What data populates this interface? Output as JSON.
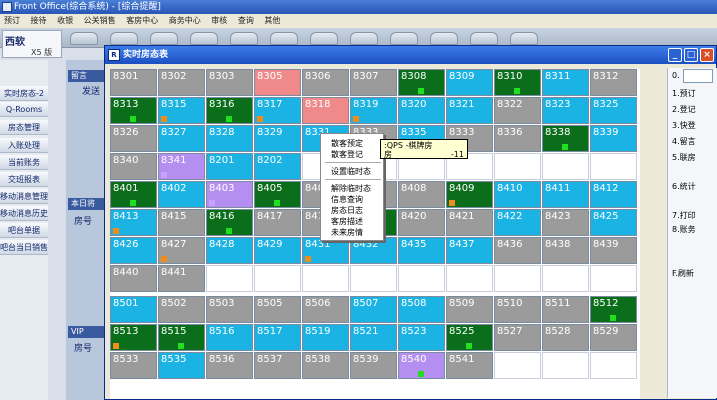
{
  "app": {
    "title": "Front Office(综合系统) - [综合提醒]",
    "menus": [
      "预订",
      "接待",
      "收银",
      "公关销售",
      "客房中心",
      "商务中心",
      "审核",
      "查询",
      "其他"
    ]
  },
  "logo": {
    "brand": "西软",
    "version": "X5 版"
  },
  "sidebar": {
    "items": [
      "实时房态-2",
      "Q-Rooms",
      "房态管理",
      "入账处理",
      "当前账务",
      "交班报表",
      "移动消息管理",
      "移动消息历史",
      "吧台单据",
      "吧台当日销售"
    ]
  },
  "midpanel": {
    "header1": "留言",
    "sub1": "发送",
    "header2": "本日将",
    "label2": "房号",
    "header3": "VIP",
    "label3": "房号"
  },
  "dialog": {
    "title": "实时房态表",
    "icon_label": "R"
  },
  "colors": {
    "gray": "#9b9b9b",
    "blue": "#1bb3e3",
    "green": "#0b6e1a",
    "pink": "#f08a8a",
    "purple": "#b48ef0",
    "marker_green": "#22dd22",
    "marker_orange": "#f08c1a",
    "marker_purple": "#c9a2ff"
  },
  "rooms": [
    [
      "8301",
      "gray",
      ""
    ],
    [
      "8302",
      "gray",
      ""
    ],
    [
      "8303",
      "gray",
      ""
    ],
    [
      "8305",
      "pink",
      ""
    ],
    [
      "8306",
      "gray",
      ""
    ],
    [
      "8307",
      "gray",
      ""
    ],
    [
      "8308",
      "green",
      "green"
    ],
    [
      "8309",
      "blue",
      ""
    ],
    [
      "8310",
      "green",
      "green"
    ],
    [
      "8311",
      "blue",
      ""
    ],
    [
      "8312",
      "gray",
      ""
    ],
    [
      "8313",
      "green",
      "green"
    ],
    [
      "8315",
      "blue",
      "orange"
    ],
    [
      "8316",
      "green",
      "green"
    ],
    [
      "8317",
      "blue",
      "orange"
    ],
    [
      "8318",
      "pink",
      ""
    ],
    [
      "8319",
      "blue",
      "orange"
    ],
    [
      "8320",
      "blue",
      ""
    ],
    [
      "8321",
      "blue",
      ""
    ],
    [
      "8322",
      "gray",
      ""
    ],
    [
      "8323",
      "blue",
      ""
    ],
    [
      "8325",
      "blue",
      ""
    ],
    [
      "8326",
      "gray",
      ""
    ],
    [
      "8327",
      "blue",
      ""
    ],
    [
      "8328",
      "blue",
      ""
    ],
    [
      "8329",
      "blue",
      ""
    ],
    [
      "8331",
      "blue",
      ""
    ],
    [
      "8333",
      "gray",
      ""
    ],
    [
      "8335",
      "blue",
      ""
    ],
    [
      "8333",
      "gray",
      ""
    ],
    [
      "8336",
      "gray",
      ""
    ],
    [
      "8338",
      "green",
      "green"
    ],
    [
      "8339",
      "blue",
      ""
    ],
    [
      "8340",
      "gray",
      ""
    ],
    [
      "8341",
      "purple",
      "purple"
    ],
    [
      "8201",
      "blue",
      ""
    ],
    [
      "8202",
      "blue",
      ""
    ],
    [
      "",
      "white",
      ""
    ],
    [
      "",
      "white",
      ""
    ],
    [
      "",
      "white",
      ""
    ],
    [
      "",
      "white",
      ""
    ],
    [
      "",
      "white",
      ""
    ],
    [
      "",
      "white",
      ""
    ],
    [
      "",
      "white",
      ""
    ],
    [
      "8401",
      "green",
      "green"
    ],
    [
      "8402",
      "blue",
      ""
    ],
    [
      "8403",
      "purple",
      "purple"
    ],
    [
      "8405",
      "green",
      "green"
    ],
    [
      "8406",
      "gray",
      ""
    ],
    [
      "8407",
      "gray",
      ""
    ],
    [
      "8408",
      "gray",
      ""
    ],
    [
      "8409",
      "green",
      "orange"
    ],
    [
      "8410",
      "blue",
      ""
    ],
    [
      "8411",
      "blue",
      ""
    ],
    [
      "8412",
      "blue",
      ""
    ],
    [
      "8413",
      "blue",
      "orange"
    ],
    [
      "8415",
      "gray",
      ""
    ],
    [
      "8416",
      "green",
      "green"
    ],
    [
      "8417",
      "gray",
      ""
    ],
    [
      "8418",
      "gray",
      ""
    ],
    [
      "8419",
      "green",
      ""
    ],
    [
      "8420",
      "gray",
      ""
    ],
    [
      "8421",
      "gray",
      ""
    ],
    [
      "8422",
      "blue",
      ""
    ],
    [
      "8423",
      "gray",
      ""
    ],
    [
      "8425",
      "blue",
      ""
    ],
    [
      "8426",
      "blue",
      ""
    ],
    [
      "8427",
      "gray",
      "orange"
    ],
    [
      "8428",
      "blue",
      ""
    ],
    [
      "8429",
      "blue",
      ""
    ],
    [
      "8431",
      "blue",
      "orange"
    ],
    [
      "8432",
      "blue",
      ""
    ],
    [
      "8435",
      "blue",
      ""
    ],
    [
      "8437",
      "blue",
      ""
    ],
    [
      "8436",
      "gray",
      ""
    ],
    [
      "8438",
      "gray",
      ""
    ],
    [
      "8439",
      "gray",
      ""
    ],
    [
      "8440",
      "gray",
      ""
    ],
    [
      "8441",
      "gray",
      ""
    ],
    [
      "",
      "white",
      ""
    ],
    [
      "",
      "white",
      ""
    ],
    [
      "",
      "white",
      ""
    ],
    [
      "",
      "white",
      ""
    ],
    [
      "",
      "white",
      ""
    ],
    [
      "",
      "white",
      ""
    ],
    [
      "",
      "white",
      ""
    ],
    [
      "",
      "white",
      ""
    ],
    [
      "",
      "white",
      ""
    ],
    [
      "8501",
      "blue",
      ""
    ],
    [
      "8502",
      "gray",
      ""
    ],
    [
      "8503",
      "gray",
      ""
    ],
    [
      "8505",
      "gray",
      ""
    ],
    [
      "8506",
      "gray",
      ""
    ],
    [
      "8507",
      "blue",
      ""
    ],
    [
      "8508",
      "blue",
      ""
    ],
    [
      "8509",
      "gray",
      ""
    ],
    [
      "8510",
      "gray",
      ""
    ],
    [
      "8511",
      "gray",
      ""
    ],
    [
      "8512",
      "green",
      "green"
    ],
    [
      "8513",
      "green",
      "orange"
    ],
    [
      "8515",
      "green",
      "green"
    ],
    [
      "8516",
      "blue",
      ""
    ],
    [
      "8517",
      "blue",
      ""
    ],
    [
      "8519",
      "blue",
      ""
    ],
    [
      "8521",
      "blue",
      ""
    ],
    [
      "8523",
      "blue",
      ""
    ],
    [
      "8525",
      "green",
      "green"
    ],
    [
      "8527",
      "gray",
      ""
    ],
    [
      "8528",
      "gray",
      ""
    ],
    [
      "8529",
      "gray",
      ""
    ],
    [
      "8533",
      "gray",
      ""
    ],
    [
      "8535",
      "blue",
      ""
    ],
    [
      "8536",
      "gray",
      ""
    ],
    [
      "8537",
      "gray",
      ""
    ],
    [
      "8538",
      "gray",
      ""
    ],
    [
      "8539",
      "gray",
      ""
    ],
    [
      "8540",
      "purple",
      "green"
    ],
    [
      "8541",
      "gray",
      ""
    ],
    [
      "",
      "white",
      ""
    ],
    [
      "",
      "white",
      ""
    ],
    [
      "",
      "white",
      ""
    ]
  ],
  "context_menu": {
    "items": [
      "散客预定",
      "散客登记",
      "设置临时态",
      "解除临时态",
      "信息查询",
      "房态日志",
      "客房描述",
      "未来房情"
    ]
  },
  "tooltip": {
    "line1": ":QPS -棋牌房",
    "line2": "房",
    "line3": "-11"
  },
  "right_panel": {
    "field_label": "0.",
    "items": [
      "1.预订",
      "2.登记",
      "3.快登",
      "4.留言",
      "5.联房",
      "6.统计",
      "7.打印",
      "8.账务",
      "F.刷新"
    ]
  }
}
